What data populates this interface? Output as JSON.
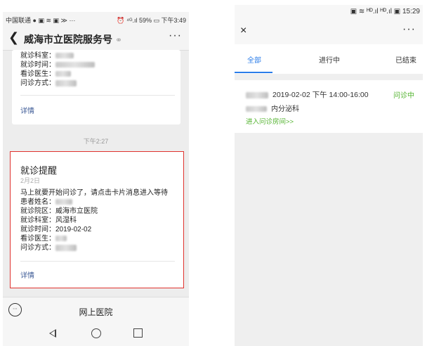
{
  "left": {
    "status": {
      "carrier": "中国联通",
      "left_icons": "● ▣ ≋ ▣ ≫ ···",
      "right": "⏰ ⁴ᴳ.ıl 59% ▭ 下午3:49"
    },
    "nav": {
      "title": "威海市立医院服务号",
      "more": "···"
    },
    "card1": {
      "lines": [
        {
          "label": "就诊科室："
        },
        {
          "label": "就诊时间："
        },
        {
          "label": "看诊医生："
        },
        {
          "label": "问诊方式："
        }
      ],
      "detail": "详情"
    },
    "timestamp": "下午2:27",
    "card2": {
      "title": "就诊提醒",
      "date": "2月2日",
      "lines": [
        {
          "text": "马上就要开始问诊了，请点击卡片消息进入等待"
        },
        {
          "text": "患者姓名："
        },
        {
          "text": "就诊院区：威海市立医院"
        },
        {
          "text": "就诊科室：风湿科"
        },
        {
          "text": "就诊时间：2019-02-02"
        },
        {
          "text": "看诊医生："
        },
        {
          "text": "问诊方式："
        }
      ],
      "detail": "详情"
    },
    "bottom": {
      "menu_label": "网上医院"
    }
  },
  "right": {
    "status": {
      "right": "▣ ≋ ᴴᴰ.ıl ᴴᴰ.ıl ▣ 15:29"
    },
    "header": {
      "close": "×",
      "more": "···"
    },
    "tabs": [
      {
        "label": "全部"
      },
      {
        "label": "进行中"
      },
      {
        "label": "已结束"
      }
    ],
    "item": {
      "datetime": "2019-02-02  下午 14:00-16:00",
      "status": "问诊中",
      "department": "内分泌科",
      "link": "进入问诊房间>>"
    }
  },
  "colors": {
    "accent_blue": "#2b7de9",
    "status_green": "#52b32e",
    "highlight_red": "#e0322e",
    "link_blue": "#3c5a96"
  }
}
